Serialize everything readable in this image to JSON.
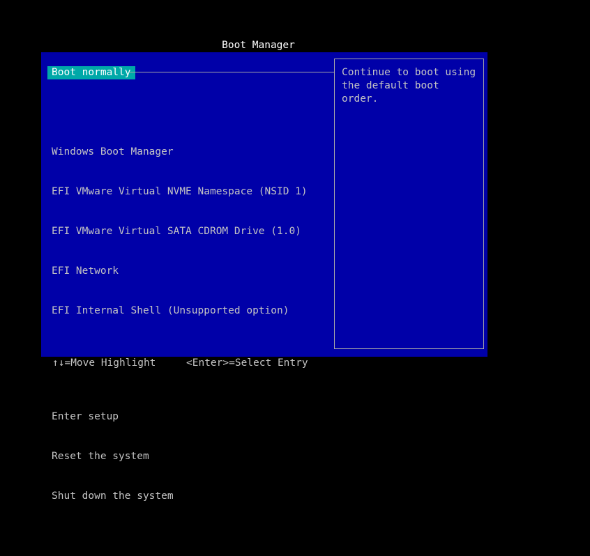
{
  "title": "Boot Manager",
  "selected_item": "Boot normally",
  "menu_groups": [
    {
      "items": [
        "Windows Boot Manager",
        "EFI VMware Virtual NVME Namespace (NSID 1)",
        "EFI VMware Virtual SATA CDROM Drive (1.0)",
        "EFI Network",
        "EFI Internal Shell (Unsupported option)"
      ]
    },
    {
      "items": [
        "Enter setup",
        "Reset the system",
        "Shut down the system"
      ]
    }
  ],
  "help": {
    "lines": [
      "Continue to boot using",
      "the default boot order."
    ]
  },
  "footer": {
    "move_hint": "↑↓=Move Highlight",
    "select_hint": "<Enter>=Select Entry"
  },
  "colors": {
    "background": "#000000",
    "panel": "#0000a8",
    "highlight": "#00a8a8",
    "text": "#c4c4c4",
    "title": "#ffffff"
  }
}
